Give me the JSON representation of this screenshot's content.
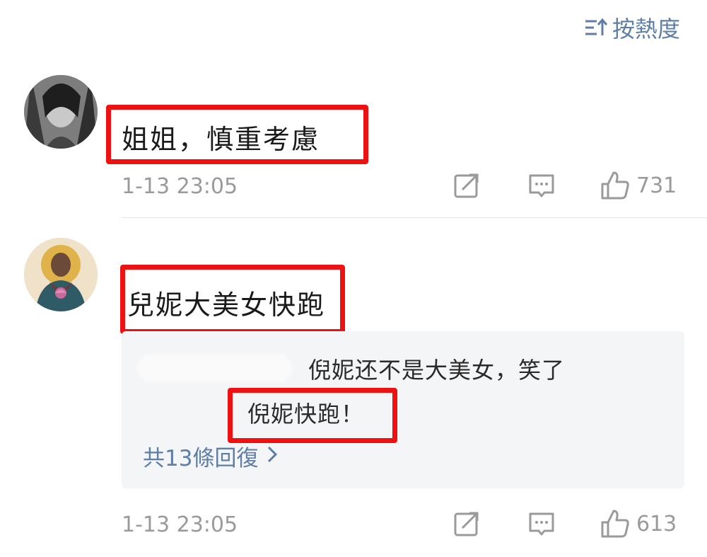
{
  "sort": {
    "label": "按熱度",
    "icon": "sort-up-icon",
    "color": "#5f7ea6"
  },
  "comments": [
    {
      "text": "姐姐，慎重考慮",
      "time": "1-13 23:05",
      "likes": "731"
    },
    {
      "text": "兒妮大美女快跑",
      "time": "1-13 23:05",
      "likes": "613",
      "replies": {
        "lines": [
          "倪妮还不是大美女，笑了",
          "倪妮快跑！"
        ],
        "more": "共13條回復"
      }
    }
  ],
  "colors": {
    "highlight": "#ee1111",
    "meta": "#9a9a9a",
    "link": "#5f7ea6"
  }
}
